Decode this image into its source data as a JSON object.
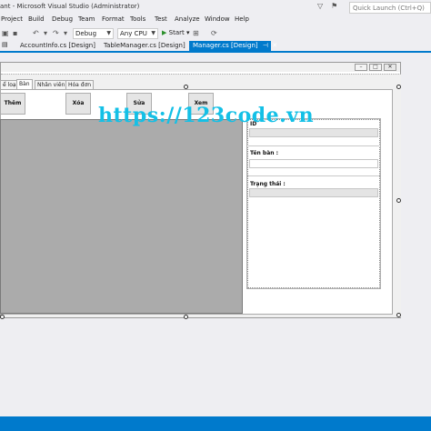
{
  "window": {
    "title": "ant - Microsoft Visual Studio (Administrator)",
    "quick_launch_placeholder": "Quick Launch (Ctrl+Q)"
  },
  "menu": [
    "Project",
    "Build",
    "Debug",
    "Team",
    "Format",
    "Tools",
    "Test",
    "Analyze",
    "Window",
    "Help"
  ],
  "toolbar": {
    "config": "Debug",
    "platform": "Any CPU",
    "start": "Start"
  },
  "doc_tabs": [
    {
      "label": "AccountInfo.cs [Design]",
      "active": false
    },
    {
      "label": "TableManager.cs [Design]",
      "active": false
    },
    {
      "label": "Manager.cs [Design]",
      "active": true
    }
  ],
  "form": {
    "tabs": [
      "ể loại",
      "Bàn",
      "Nhân viên",
      "Hóa đơn"
    ],
    "selected_tab": "Bàn",
    "buttons": {
      "add": "Thêm",
      "delete": "Xóa",
      "edit": "Sửa",
      "view": "Xem"
    },
    "labels": {
      "id": "ID",
      "name": "Tên bàn :",
      "status": "Trạng thái :"
    }
  },
  "watermark": "https://123code.vn",
  "colors": {
    "accent": "#007acc",
    "grid_bg": "#ababab",
    "watermark": "#14c0e6"
  }
}
